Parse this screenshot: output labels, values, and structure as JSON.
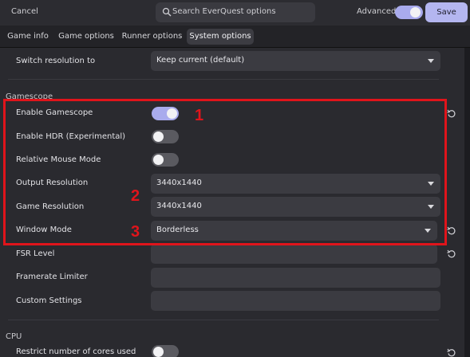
{
  "header": {
    "cancel_label": "Cancel",
    "search_placeholder": "Search EverQuest options",
    "advanced_label": "Advanced",
    "save_label": "Save"
  },
  "tabs": [
    {
      "label": "Game info"
    },
    {
      "label": "Game options"
    },
    {
      "label": "Runner options"
    },
    {
      "label": "System options"
    }
  ],
  "active_tab": "System options",
  "display": {
    "switch_resolution_label": "Switch resolution to",
    "switch_resolution_value": "Keep current (default)"
  },
  "gamescope": {
    "section_title": "Gamescope",
    "enable_gamescope_label": "Enable Gamescope",
    "enable_gamescope_on": true,
    "enable_hdr_label": "Enable HDR (Experimental)",
    "enable_hdr_on": false,
    "relative_mouse_label": "Relative Mouse Mode",
    "relative_mouse_on": false,
    "output_resolution_label": "Output Resolution",
    "output_resolution_value": "3440x1440",
    "game_resolution_label": "Game Resolution",
    "game_resolution_value": "3440x1440",
    "window_mode_label": "Window Mode",
    "window_mode_value": "Borderless",
    "fsr_level_label": "FSR Level",
    "fsr_level_value": "",
    "framerate_limiter_label": "Framerate Limiter",
    "framerate_limiter_value": "",
    "custom_settings_label": "Custom Settings",
    "custom_settings_value": ""
  },
  "cpu": {
    "section_title": "CPU",
    "restrict_cores_label": "Restrict number of cores used",
    "restrict_cores_on": false
  },
  "annotations": [
    "1",
    "2",
    "3"
  ],
  "colors": {
    "accent": "#a9abed",
    "save_button": "#b4b6f0",
    "highlight": "#e0141b"
  }
}
